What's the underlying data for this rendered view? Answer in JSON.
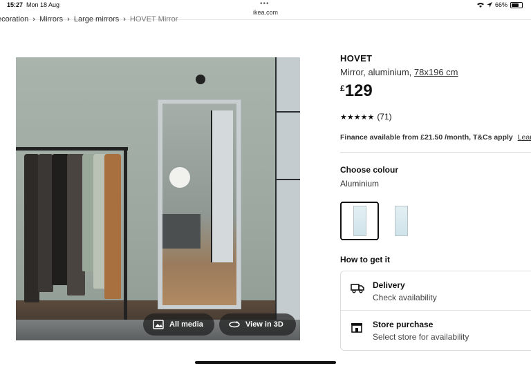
{
  "status_bar": {
    "time": "15:27",
    "date": "Mon 18 Aug",
    "url": "ikea.com",
    "battery": "66%"
  },
  "breadcrumb": {
    "items": [
      "ecoration",
      "Mirrors",
      "Large mirrors",
      "HOVET Mirror"
    ]
  },
  "gallery": {
    "all_media_label": "All media",
    "view_3d_label": "View in 3D"
  },
  "product": {
    "name": "HOVET",
    "description": "Mirror, aluminium,",
    "measurement": "78x196 cm",
    "currency": "£",
    "price": "129",
    "rating_count": "(71)",
    "finance_text": "Finance available from £21.50 /month, T&Cs apply",
    "learn_more": "Learn m"
  },
  "colour": {
    "title": "Choose colour",
    "selected": "Aluminium"
  },
  "get_it": {
    "title": "How to get it",
    "delivery_label": "Delivery",
    "delivery_sub": "Check availability",
    "store_label": "Store purchase",
    "store_sub": "Select store for availability"
  },
  "colors": {
    "text": "#111111",
    "divider": "#dcdcdc",
    "pill_bg": "#1e1e1e"
  }
}
